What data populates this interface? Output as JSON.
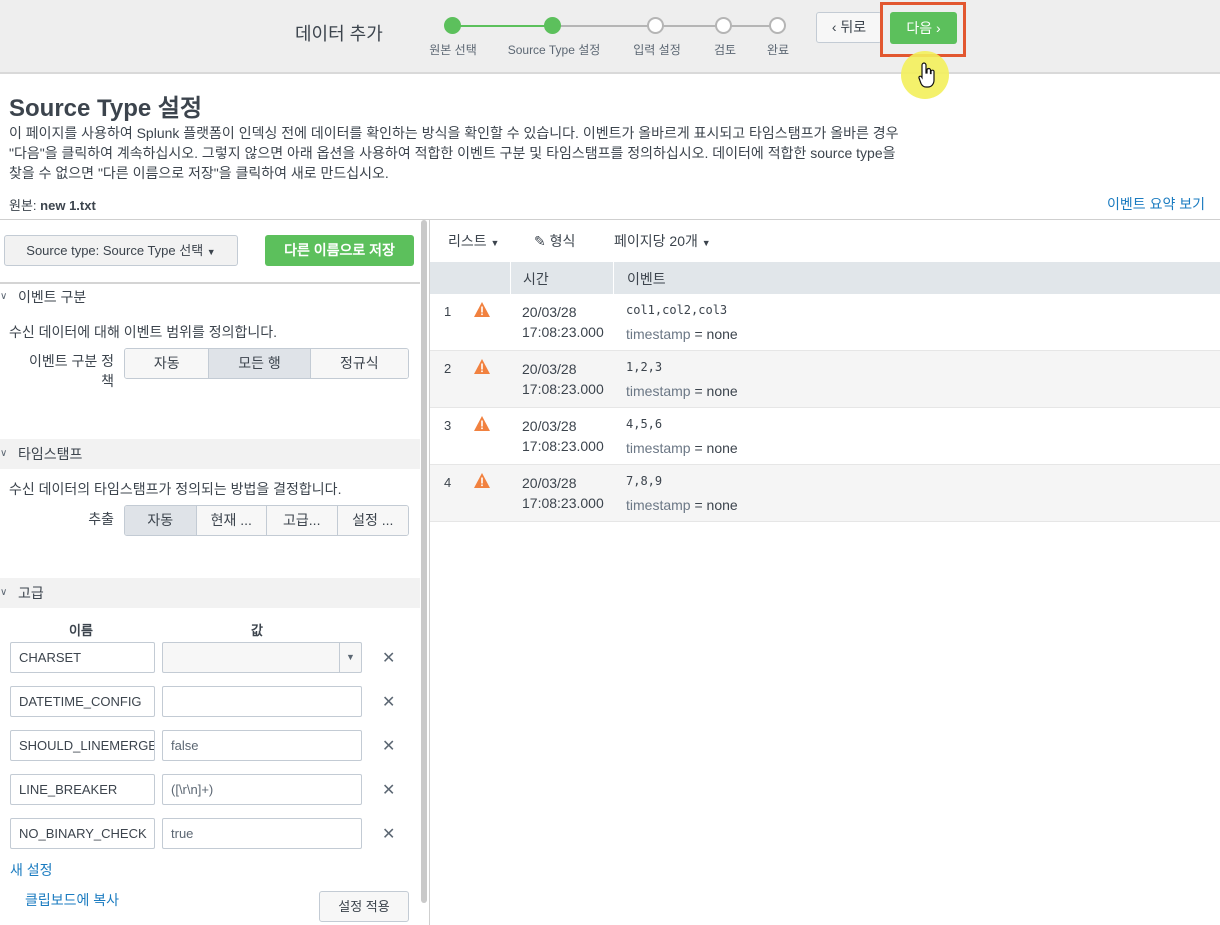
{
  "wizard": {
    "title": "데이터 추가",
    "steps": [
      "원본 선택",
      "Source Type 설정",
      "입력 설정",
      "검토",
      "완료"
    ],
    "back_label": "뒤로",
    "next_label": "다음",
    "colors": {
      "accent": "#5cc05c",
      "highlight": "#e2572f",
      "link": "#1a7bc0"
    }
  },
  "header": {
    "title": "Source Type 설정",
    "description": "이 페이지를 사용하여 Splunk 플랫폼이 인덱싱 전에 데이터를 확인하는 방식을 확인할 수 있습니다. 이벤트가 올바르게 표시되고 타임스탬프가 올바른 경우 \"다음\"을 클릭하여 계속하십시오. 그렇지 않으면 아래 옵션을 사용하여 적합한 이벤트 구분 및 타임스탬프를 정의하십시오. 데이터에 적합한 source type을 찾을 수 없으면 \"다른 이름으로 저장\"을 클릭하여 새로 만드십시오.",
    "source_label": "원본:",
    "source_value": "new 1.txt",
    "event_summary_link": "이벤트 요약 보기"
  },
  "left": {
    "source_type_select": "Source type: Source Type 선택",
    "save_as_label": "다른 이름으로 저장",
    "event_break": {
      "title": "이벤트 구분",
      "description": "수신 데이터에 대해 이벤트 범위를 정의합니다.",
      "policy_label": "이벤트 구분 정책",
      "options": [
        "자동",
        "모든 행",
        "정규식"
      ],
      "selected": "모든 행"
    },
    "timestamp": {
      "title": "타임스탬프",
      "description": "수신 데이터의 타임스탬프가 정의되는 방법을 결정합니다.",
      "extract_label": "추출",
      "options": [
        "자동",
        "현재 ...",
        "고급...",
        "설정 ..."
      ],
      "selected": "자동"
    },
    "advanced": {
      "title": "고급",
      "name_header": "이름",
      "value_header": "값",
      "rows": [
        {
          "name": "CHARSET",
          "value": ""
        },
        {
          "name": "DATETIME_CONFIG",
          "value": ""
        },
        {
          "name": "SHOULD_LINEMERGE",
          "value": "false"
        },
        {
          "name": "LINE_BREAKER",
          "value": "([\\r\\n]+)"
        },
        {
          "name": "NO_BINARY_CHECK",
          "value": "true"
        }
      ],
      "new_setting": "새 설정",
      "copy_to_clipboard": "클립보드에 복사",
      "apply_label": "설정 적용"
    }
  },
  "right": {
    "toolbar": {
      "list": "리스트",
      "format": "형식",
      "per_page": "페이지당 20개"
    },
    "columns": {
      "time": "시간",
      "event": "이벤트"
    },
    "events": [
      {
        "num": "1",
        "date": "20/03/28",
        "time": "17:08:23.000",
        "text": "col1,col2,col3",
        "ts_key": "timestamp",
        "ts_eq": " = ",
        "ts_val": "none"
      },
      {
        "num": "2",
        "date": "20/03/28",
        "time": "17:08:23.000",
        "text": "1,2,3",
        "ts_key": "timestamp",
        "ts_eq": " = ",
        "ts_val": "none"
      },
      {
        "num": "3",
        "date": "20/03/28",
        "time": "17:08:23.000",
        "text": "4,5,6",
        "ts_key": "timestamp",
        "ts_eq": " = ",
        "ts_val": "none"
      },
      {
        "num": "4",
        "date": "20/03/28",
        "time": "17:08:23.000",
        "text": "7,8,9",
        "ts_key": "timestamp",
        "ts_eq": " = ",
        "ts_val": "none"
      }
    ]
  }
}
